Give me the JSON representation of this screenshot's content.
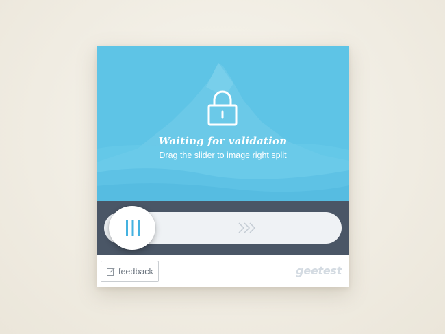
{
  "captcha": {
    "status_title": "Waiting for validation",
    "status_subtitle": "Drag the slider to image right split",
    "slider_position": 0,
    "icons": {
      "lock": "lock-icon",
      "handle": "grip-lines-icon",
      "arrows": "chevron-right-triple-icon",
      "feedback": "edit-icon"
    },
    "colors": {
      "image_bg": "#5ec4e6",
      "slider_bar": "#4a5666",
      "track": "#eff2f5",
      "handle_grip": "#45b2e0",
      "brand": "#d4dbe2"
    }
  },
  "footer": {
    "feedback_label": "feedback",
    "brand": "geetest"
  }
}
